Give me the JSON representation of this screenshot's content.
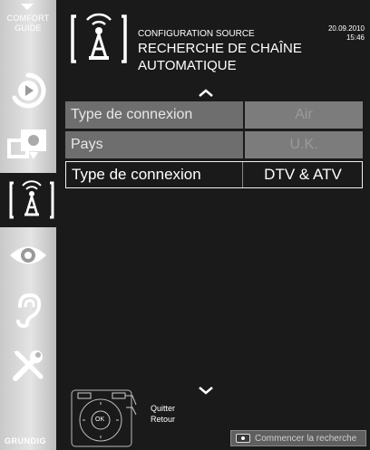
{
  "sidebar": {
    "comfort_line1": "COMFORT",
    "comfort_line2": "GUIDE",
    "items": [
      {
        "icon": "play-icon"
      },
      {
        "icon": "picture-icon"
      },
      {
        "icon": "antenna-icon",
        "active": true
      },
      {
        "icon": "eye-icon"
      },
      {
        "icon": "ear-icon"
      },
      {
        "icon": "tools-icon"
      }
    ],
    "logo": "GRUNDIG"
  },
  "header": {
    "section": "CONFIGURATION SOURCE",
    "title_line1": "RECHERCHE DE CHAÎNE",
    "title_line2": "AUTOMATIQUE",
    "date": "20.09.2010",
    "time": "15:46"
  },
  "settings": [
    {
      "label": "Type de connexion",
      "value": "Air",
      "state": "disabled"
    },
    {
      "label": "Pays",
      "value": "U.K.",
      "state": "disabled"
    },
    {
      "label": "Type de connexion",
      "value": "DTV & ATV",
      "state": "selected"
    }
  ],
  "remote_hints": {
    "quit": "Quitter",
    "back": "Retour",
    "ok": "OK"
  },
  "footer": {
    "start_search": "Commencer la recherche"
  },
  "colors": {
    "background": "#1a1a1a",
    "sidebar": "#d8d8d8",
    "row_disabled": "#6e6e6e",
    "value_disabled": "#7c7c7c"
  }
}
